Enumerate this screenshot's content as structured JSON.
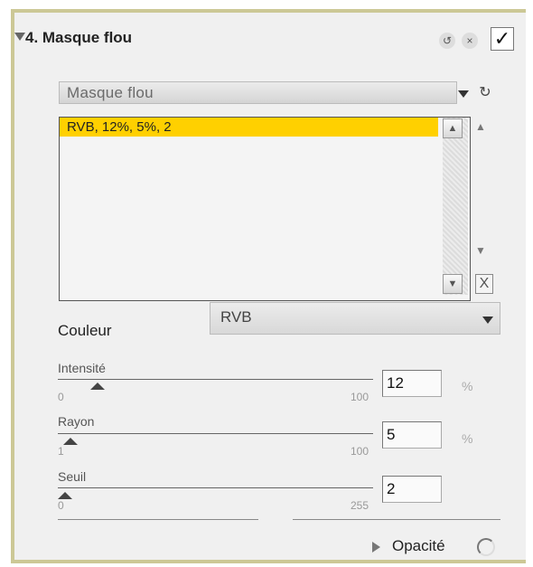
{
  "panel": {
    "title": "4. Masque flou"
  },
  "preset": {
    "selected": "Masque flou"
  },
  "list": {
    "items": [
      "RVB, 12%, 5%, 2"
    ]
  },
  "couleur": {
    "label": "Couleur",
    "value": "RVB"
  },
  "sliders": [
    {
      "label": "Intensité",
      "min": "0",
      "max": "100",
      "value": "12",
      "unit": "%"
    },
    {
      "label": "Rayon",
      "min": "1",
      "max": "100",
      "value": "5",
      "unit": "%"
    },
    {
      "label": "Seuil",
      "min": "0",
      "max": "255",
      "value": "2",
      "unit": ""
    }
  ],
  "footer": {
    "opacity_label": "Opacité"
  },
  "icons": {
    "collapse": "triangle-down-icon",
    "reset": "undo-icon",
    "remove": "close-icon",
    "enable": "checkmark-icon",
    "refresh": "refresh-icon",
    "expand": "play-icon"
  },
  "colors": {
    "selection": "#ffd000",
    "frame": "#ccc896",
    "background": "#f0f0f0"
  }
}
